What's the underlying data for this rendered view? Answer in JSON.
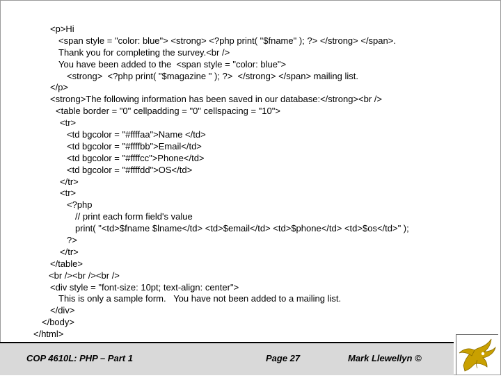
{
  "code_lines": [
    {
      "indent": 72,
      "text": "<p>Hi"
    },
    {
      "indent": 84,
      "text": "<span style = \"color: blue\"> <strong> <?php print( \"$fname\" ); ?> </strong> </span>."
    },
    {
      "indent": 84,
      "text": "Thank you for completing the survey.<br />"
    },
    {
      "indent": 84,
      "text": "You have been added to the  <span style = \"color: blue\">"
    },
    {
      "indent": 96,
      "text": "<strong>  <?php print( \"$magazine \" ); ?>  </strong> </span> mailing list."
    },
    {
      "indent": 72,
      "text": "</p>"
    },
    {
      "indent": 72,
      "text": "<strong>The following information has been saved in our database:</strong><br />"
    },
    {
      "indent": 80,
      "text": "<table border = \"0\" cellpadding = \"0\" cellspacing = \"10\">"
    },
    {
      "indent": 86,
      "text": "<tr>"
    },
    {
      "indent": 96,
      "text": "<td bgcolor = \"#ffffaa\">Name </td>"
    },
    {
      "indent": 96,
      "text": "<td bgcolor = \"#ffffbb\">Email</td>"
    },
    {
      "indent": 96,
      "text": "<td bgcolor = \"#ffffcc\">Phone</td>"
    },
    {
      "indent": 96,
      "text": "<td bgcolor = \"#ffffdd\">OS</td>"
    },
    {
      "indent": 86,
      "text": "</tr>"
    },
    {
      "indent": 86,
      "text": "<tr>"
    },
    {
      "indent": 96,
      "text": "<?php"
    },
    {
      "indent": 108,
      "text": "// print each form field's value"
    },
    {
      "indent": 108,
      "text": "print( \"<td>$fname $lname</td> <td>$email</td> <td>$phone</td> <td>$os</td>\" );"
    },
    {
      "indent": 96,
      "text": "?>"
    },
    {
      "indent": 86,
      "text": "</tr>"
    },
    {
      "indent": 72,
      "text": "</table>"
    },
    {
      "indent": 70,
      "text": "<br /><br /><br />"
    },
    {
      "indent": 72,
      "text": "<div style = \"font-size: 10pt; text-align: center\">"
    },
    {
      "indent": 84,
      "text": "This is only a sample form.   You have not been added to a mailing list."
    },
    {
      "indent": 72,
      "text": "</div>"
    },
    {
      "indent": 60,
      "text": "</body>"
    },
    {
      "indent": 48,
      "text": "</html>"
    }
  ],
  "footer": {
    "course": "COP 4610L: PHP – Part 1",
    "page": "Page 27",
    "author": "Mark Llewellyn ©"
  },
  "logo": {
    "icon": "pegasus-logo-icon",
    "color": "#c9a000"
  }
}
